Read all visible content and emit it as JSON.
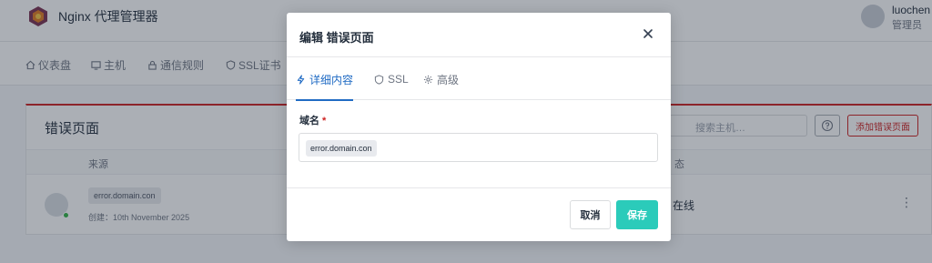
{
  "app": {
    "title": "Nginx 代理管理器"
  },
  "user": {
    "name": "luochen",
    "role": "管理员"
  },
  "nav": [
    {
      "label": "仪表盘",
      "icon": "home-icon"
    },
    {
      "label": "主机",
      "icon": "monitor-icon"
    },
    {
      "label": "通信规则",
      "icon": "lock-icon"
    },
    {
      "label": "SSL证书",
      "icon": "shield-icon"
    }
  ],
  "page": {
    "title": "错误页面",
    "search_placeholder": "搜索主机…",
    "add_button": "添加错误页面",
    "columns": {
      "source": "来源",
      "status": "态"
    },
    "row": {
      "domain": "error.domain.con",
      "created_label": "创建：",
      "created_date": "10th November 2025",
      "status": "在线"
    }
  },
  "modal": {
    "title": "编辑 错误页面",
    "tabs": [
      {
        "label": "详细内容",
        "icon": "lightning-icon",
        "active": true
      },
      {
        "label": "SSL",
        "icon": "shield-icon",
        "active": false
      },
      {
        "label": "高级",
        "icon": "gear-icon",
        "active": false
      }
    ],
    "field_label": "域名",
    "required_mark": "*",
    "domain_chip": "error.domain.con",
    "cancel_label": "取消",
    "save_label": "保存"
  },
  "colors": {
    "accent": "#206bc4",
    "danger": "#cd201f",
    "save": "#2bcbba",
    "online": "#2fb344"
  }
}
